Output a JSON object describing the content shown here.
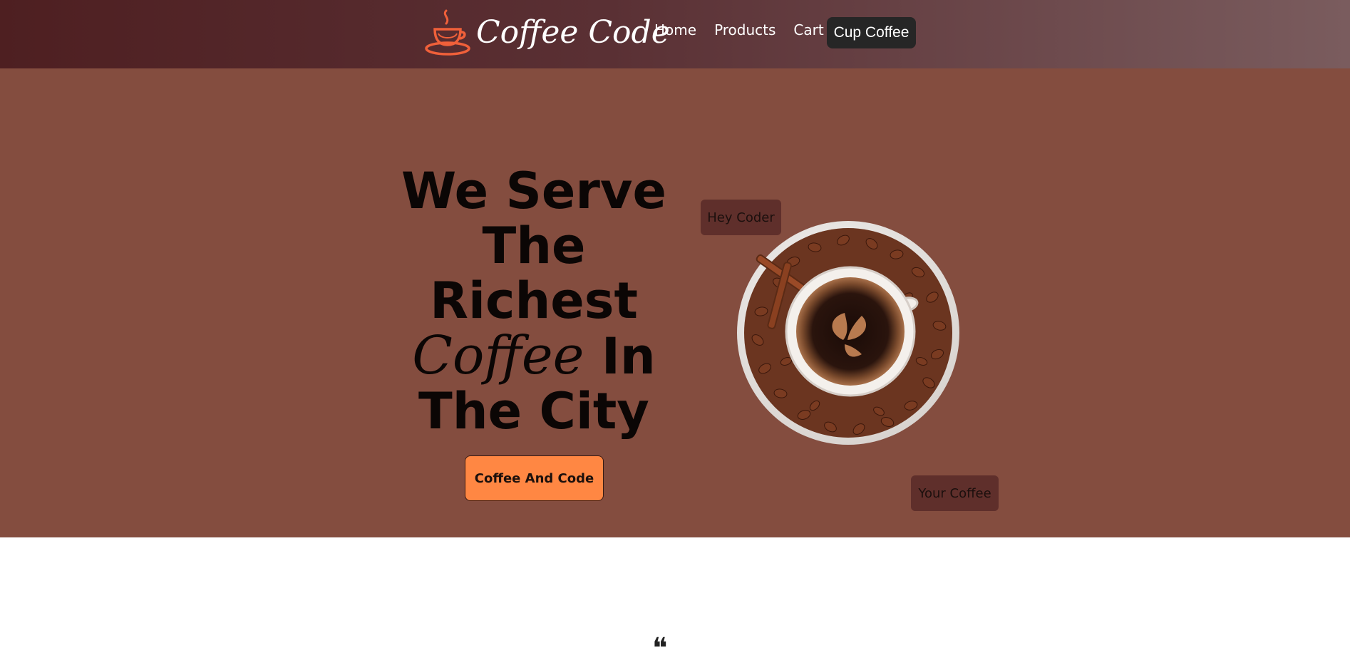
{
  "navbar": {
    "brand_name": "Coffee Code",
    "brand_icon": "coffee-cup-icon",
    "links": [
      {
        "label": "Home"
      },
      {
        "label": "Products"
      },
      {
        "label": "Cart"
      }
    ],
    "button_label": "Cup Coffee"
  },
  "hero": {
    "headline_line1": "We Serve",
    "headline_line2": "The",
    "headline_line3": "Richest",
    "headline_cursive": "Coffee",
    "headline_line4_rest": " In",
    "headline_line5": "The City",
    "cta_label": "Coffee And Code",
    "tag_top": "Hey Coder",
    "tag_bottom": "Your Coffee",
    "image_name": "coffee-cup-with-beans-image"
  },
  "colors": {
    "nav_gradient_start": "#4e1f21",
    "nav_gradient_end": "#7a5c5e",
    "hero_background": "#844d3f",
    "accent_orange": "#ff8743",
    "tag_background": "#5f2f2b",
    "nav_button_background": "#262626"
  }
}
